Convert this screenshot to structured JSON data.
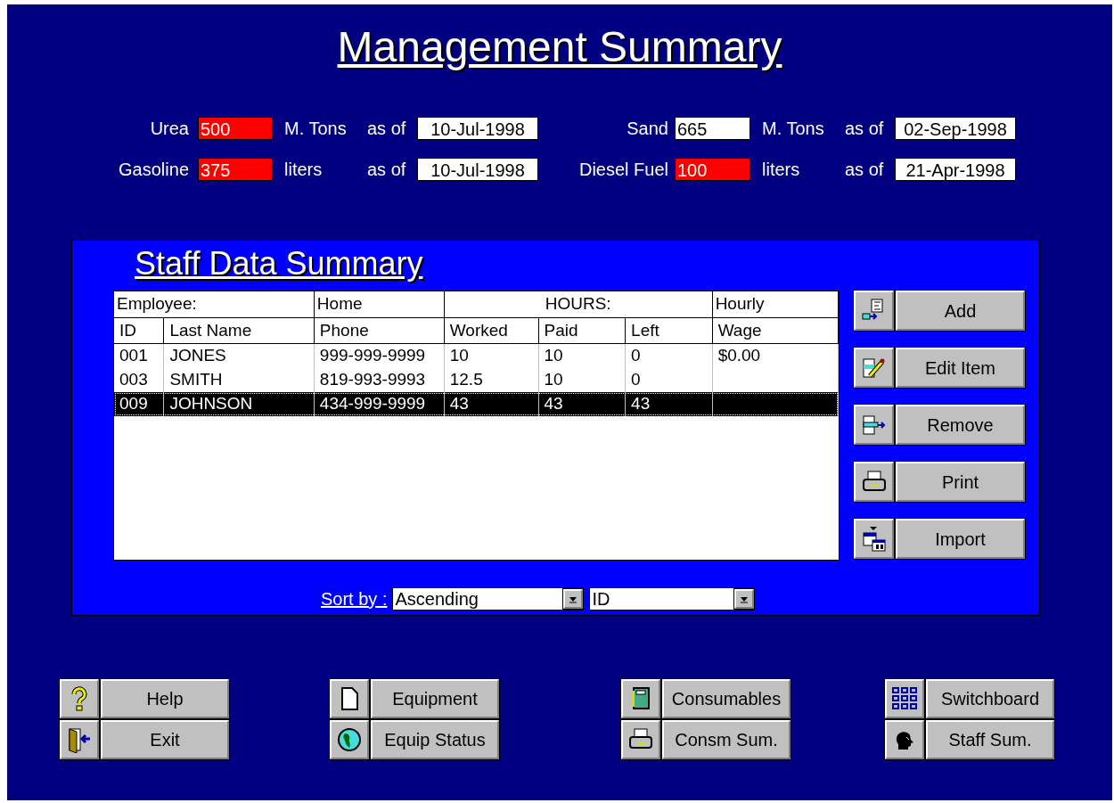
{
  "title": "Management Summary",
  "stocks": [
    {
      "label": "Urea",
      "value": "500",
      "alert": true,
      "unit": "M. Tons",
      "as_of": "as of",
      "date": "10-Jul-1998"
    },
    {
      "label": "Sand",
      "value": "665",
      "alert": false,
      "unit": "M. Tons",
      "as_of": "as of",
      "date": "02-Sep-1998"
    },
    {
      "label": "Gasoline",
      "value": "375",
      "alert": true,
      "unit": "liters",
      "as_of": "as of",
      "date": "10-Jul-1998"
    },
    {
      "label": "Diesel Fuel",
      "value": "100",
      "alert": true,
      "unit": "liters",
      "as_of": "as of",
      "date": "21-Apr-1998"
    }
  ],
  "staff_panel": {
    "title": "Staff Data Summary",
    "table": {
      "header_groups": [
        "Employee:",
        "Home",
        "HOURS:",
        "Hourly"
      ],
      "columns": [
        "ID",
        "Last Name",
        "Phone",
        "Worked",
        "Paid",
        "Left",
        "Wage"
      ],
      "rows": [
        {
          "cells": [
            "001",
            "JONES",
            "999-999-9999",
            "10",
            "10",
            "0",
            "$0.00"
          ],
          "selected": false
        },
        {
          "cells": [
            "003",
            "SMITH",
            "819-993-9993",
            "12.5",
            "10",
            "0"
          ],
          "selected": false
        },
        {
          "cells": [
            "009",
            "JOHNSON",
            "434-999-9999",
            "43",
            "43",
            "43"
          ],
          "selected": true
        }
      ]
    },
    "actions": [
      {
        "label": "Add"
      },
      {
        "label": "Edit Item"
      },
      {
        "label": "Remove"
      },
      {
        "label": "Print"
      },
      {
        "label": "Import"
      }
    ],
    "sort": {
      "label": "Sort by :",
      "order": "Ascending",
      "field": "ID"
    }
  },
  "nav_groups": [
    [
      {
        "label": "Help"
      },
      {
        "label": "Exit"
      }
    ],
    [
      {
        "label": "Equipment"
      },
      {
        "label": "Equip Status"
      }
    ],
    [
      {
        "label": "Consumables"
      },
      {
        "label": "Consm Sum."
      }
    ],
    [
      {
        "label": "Switchboard"
      },
      {
        "label": "Staff Sum."
      }
    ]
  ]
}
